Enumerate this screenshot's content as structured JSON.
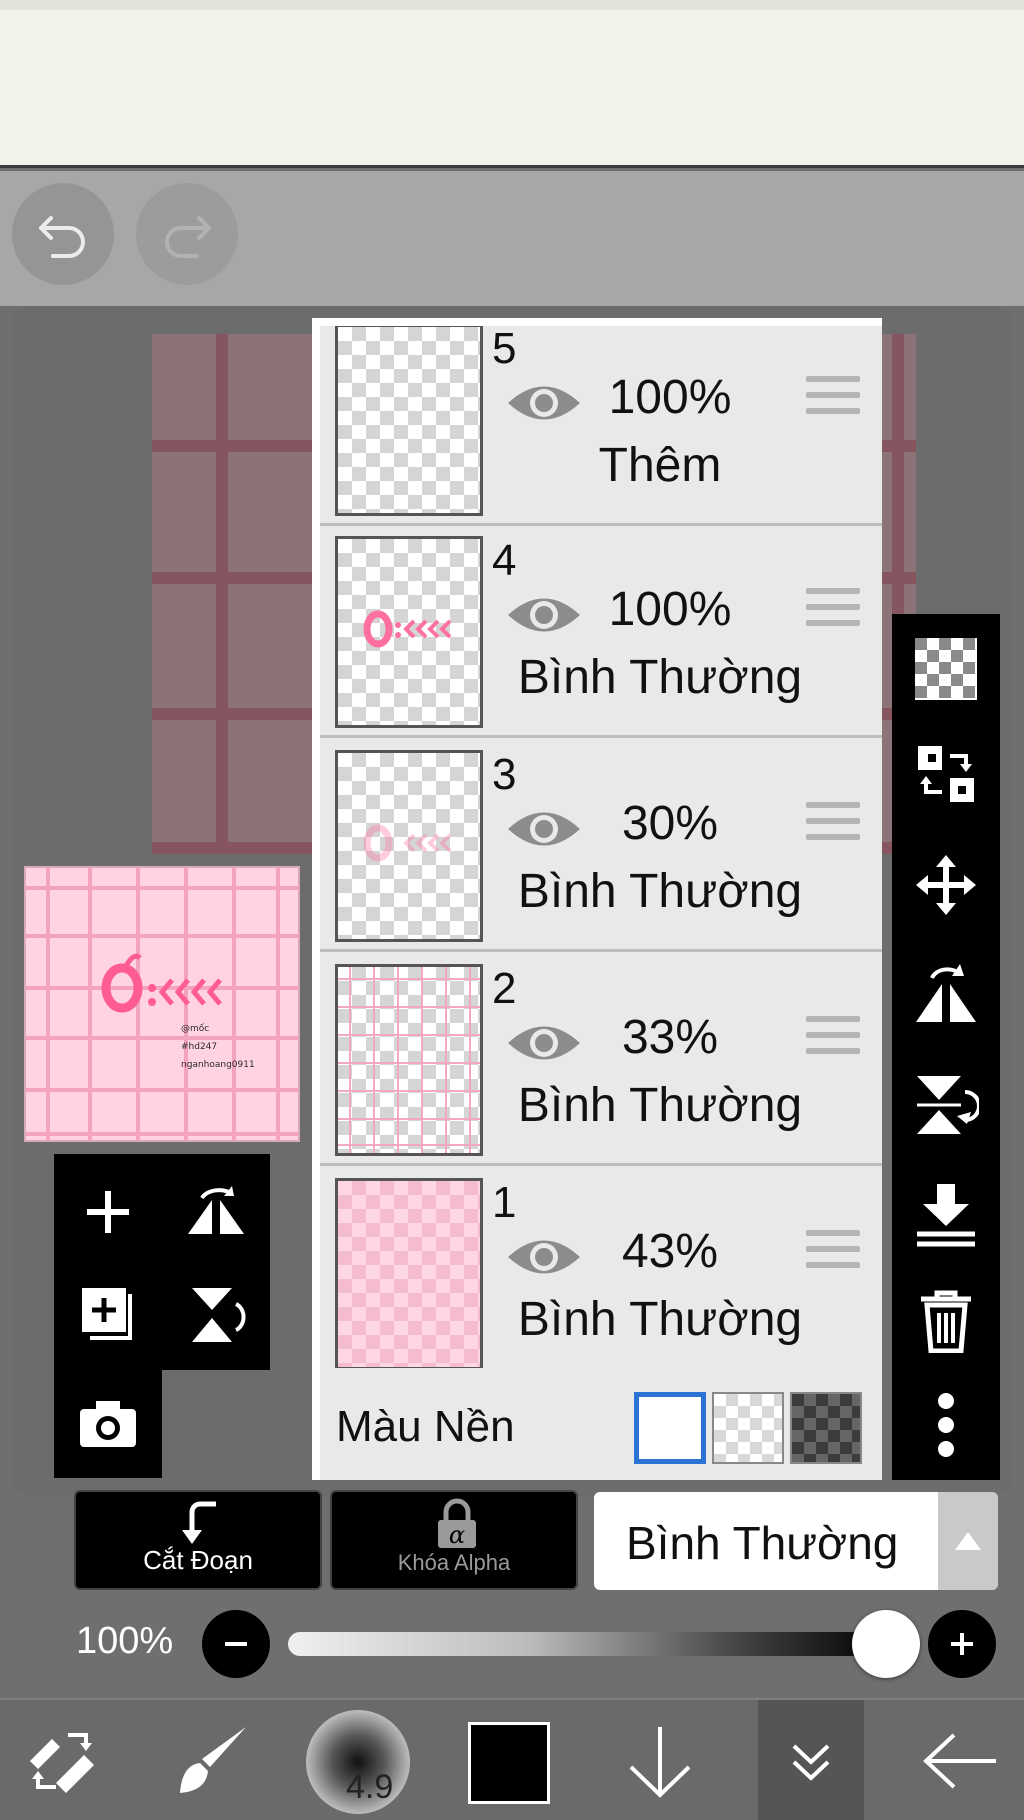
{
  "toolbar": {
    "undo": "undo-icon",
    "redo": "redo-icon"
  },
  "preview": {
    "lines": [
      "@mốc",
      "#hd247",
      "nganhoang0911"
    ]
  },
  "layers": [
    {
      "number": "5",
      "opacity": "100%",
      "blend": "Thêm"
    },
    {
      "number": "4",
      "opacity": "100%",
      "blend": "Bình Thường"
    },
    {
      "number": "3",
      "opacity": "30%",
      "blend": "Bình Thường"
    },
    {
      "number": "2",
      "opacity": "33%",
      "blend": "Bình Thường"
    },
    {
      "number": "1",
      "opacity": "43%",
      "blend": "Bình Thường"
    }
  ],
  "background": {
    "label": "Màu Nền",
    "options": [
      "white",
      "transparent",
      "dark-checker"
    ],
    "selected": "white"
  },
  "actions": {
    "clip_label": "Cắt Đoạn",
    "alpha_lock_label": "Khóa Alpha",
    "blend_mode": "Bình Thường"
  },
  "opacity_slider": {
    "label": "100%",
    "value": 1.0
  },
  "bottom": {
    "brush_size": "4.9",
    "color": "#000000"
  }
}
